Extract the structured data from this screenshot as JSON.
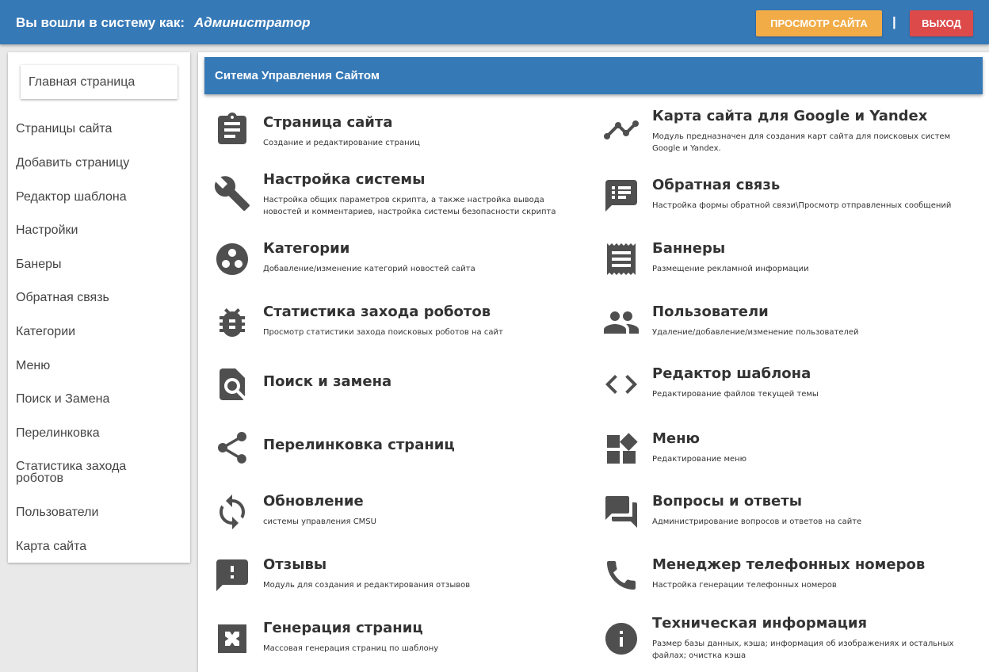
{
  "header": {
    "login_label": "Вы вошли в систему как:",
    "user_name": "Администратор",
    "view_site_label": "ПРОСМОТР САЙТА",
    "separator": "|",
    "exit_label": "ВЫХОД",
    "colors": {
      "bar": "#3679b7",
      "view_button": "#f1ac48",
      "exit_button": "#dc4a4a"
    }
  },
  "sidebar": {
    "home_label": "Главная страница",
    "items": [
      {
        "label": "Страницы сайта"
      },
      {
        "label": "Добавить страницу"
      },
      {
        "label": "Редактор шаблона"
      },
      {
        "label": "Настройки"
      },
      {
        "label": "Банеры"
      },
      {
        "label": "Обратная связь"
      },
      {
        "label": "Категории"
      },
      {
        "label": "Меню"
      },
      {
        "label": "Поиск и Замена"
      },
      {
        "label": "Перелинковка"
      },
      {
        "label": "Статистика захода роботов"
      },
      {
        "label": "Пользователи"
      },
      {
        "label": "Карта сайта"
      }
    ]
  },
  "main": {
    "title": "Ситема Управления Сайтом",
    "cards": [
      {
        "icon": "clipboard-icon",
        "title": "Страница сайта",
        "desc": "Создание и редактирование страниц"
      },
      {
        "icon": "timeline-icon",
        "title": "Карта сайта для Google и Yandex",
        "desc": "Модуль предназначен для создания карт сайта для поисковых систем Google и Yandex."
      },
      {
        "icon": "wrench-icon",
        "title": "Настройка системы",
        "desc": "Настройка общих параметров скрипта, а также настройка вывода новостей и комментариев, настройка системы безопасности скрипта"
      },
      {
        "icon": "feedback-icon",
        "title": "Обратная связь",
        "desc": "Настройка формы обратной связи\\Просмотр отправленных сообщений"
      },
      {
        "icon": "categories-icon",
        "title": "Категории",
        "desc": "Добавление/изменение категорий новостей сайта"
      },
      {
        "icon": "receipt-icon",
        "title": "Баннеры",
        "desc": "Размещение рекламной информации"
      },
      {
        "icon": "bug-icon",
        "title": "Статистика захода роботов",
        "desc": "Просмотр статистики захода поисковых роботов на сайт"
      },
      {
        "icon": "users-icon",
        "title": "Пользователи",
        "desc": "Удаление/добавление/изменение пользователей"
      },
      {
        "icon": "find-file-icon",
        "title": "Поиск и замена",
        "desc": ""
      },
      {
        "icon": "code-icon",
        "title": "Редактор шаблона",
        "desc": "Редактирование файлов текущей темы"
      },
      {
        "icon": "share-icon",
        "title": "Перелинковка страниц",
        "desc": ""
      },
      {
        "icon": "widgets-icon",
        "title": "Меню",
        "desc": "Редактирование меню"
      },
      {
        "icon": "sync-icon",
        "title": "Обновление",
        "desc": "системы управления CMSU"
      },
      {
        "icon": "forum-icon",
        "title": "Вопросы и ответы",
        "desc": "Администрирование вопросов и ответов на сайте"
      },
      {
        "icon": "alert-comment-icon",
        "title": "Отзывы",
        "desc": "Модуль для создания и редактирования отзывов"
      },
      {
        "icon": "phone-icon",
        "title": "Менеджер телефонных номеров",
        "desc": "Настройка генерации телефонных номеров"
      },
      {
        "icon": "generate-icon",
        "title": "Генерация страниц",
        "desc": "Массовая генерация страниц по шаблону"
      },
      {
        "icon": "info-icon",
        "title": "Техническая информация",
        "desc": "Размер базы данных, кэша; информация об изображениях и остальных файлах; очистка кэша"
      }
    ]
  }
}
